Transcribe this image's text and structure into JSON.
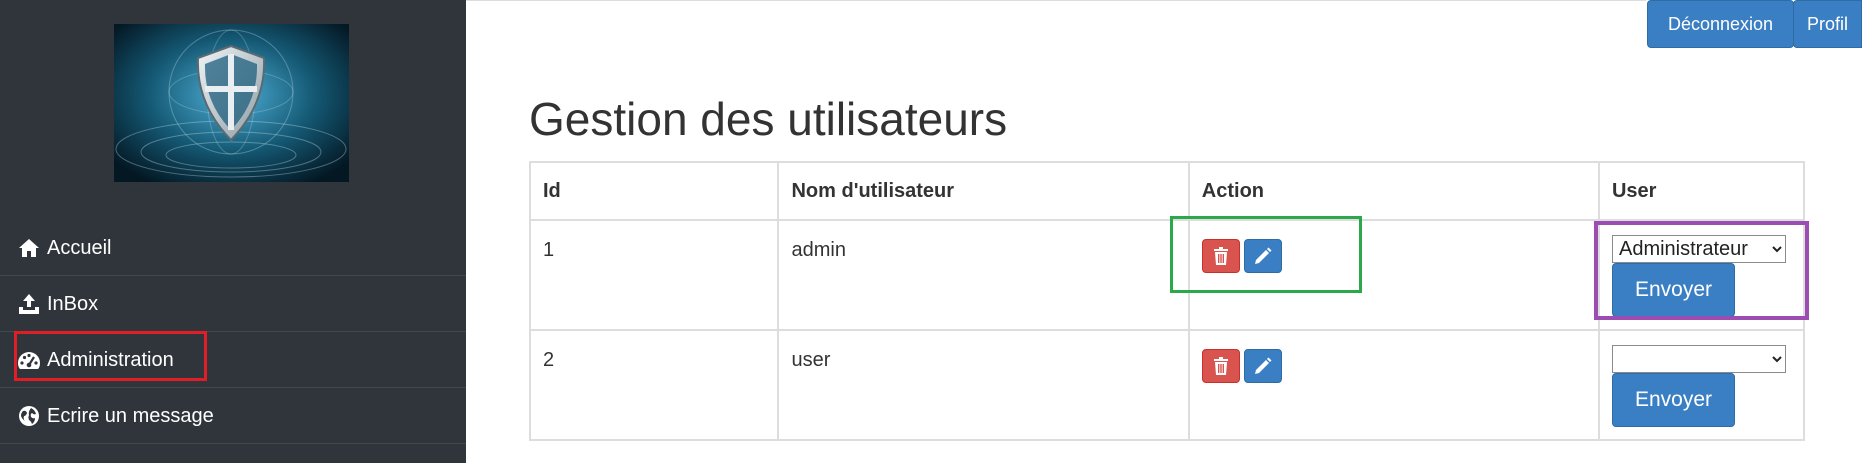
{
  "topbar": {
    "logout_label": "Déconnexion",
    "profile_label": "Profil"
  },
  "sidebar": {
    "items": [
      {
        "label": "Accueil",
        "icon": "home-icon"
      },
      {
        "label": "InBox",
        "icon": "upload-icon"
      },
      {
        "label": "Administration",
        "icon": "dashboard-icon"
      },
      {
        "label": "Ecrire un message",
        "icon": "globe-icon"
      }
    ]
  },
  "page": {
    "title": "Gestion des utilisateurs"
  },
  "table": {
    "headers": [
      "Id",
      "Nom d'utilisateur",
      "Action",
      "User"
    ],
    "rows": [
      {
        "id": "1",
        "username": "admin",
        "role_selected": "Administrateur",
        "send_label": "Envoyer"
      },
      {
        "id": "2",
        "username": "user",
        "role_selected": "",
        "send_label": "Envoyer"
      }
    ]
  },
  "colors": {
    "sidebar_bg": "#2f353b",
    "primary": "#3a7fc4",
    "danger": "#d9534f",
    "highlight_red": "#e11d25",
    "highlight_green": "#2aa84a",
    "highlight_purple": "#9b4db1"
  }
}
